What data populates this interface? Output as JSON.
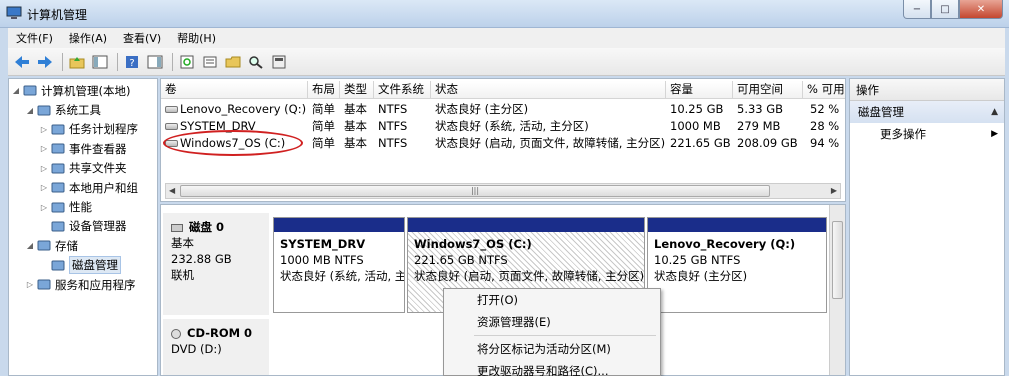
{
  "window": {
    "title": "计算机管理",
    "controls": [
      "−",
      "□",
      "✕"
    ]
  },
  "menu": [
    "文件(F)",
    "操作(A)",
    "查看(V)",
    "帮助(H)"
  ],
  "tree": [
    {
      "label": "计算机管理(本地)",
      "indent": 0,
      "twisty": "◢",
      "icon": "computer-icon"
    },
    {
      "label": "系统工具",
      "indent": 1,
      "twisty": "◢",
      "icon": "tools-icon"
    },
    {
      "label": "任务计划程序",
      "indent": 2,
      "twisty": "▷",
      "icon": "clock-icon"
    },
    {
      "label": "事件查看器",
      "indent": 2,
      "twisty": "▷",
      "icon": "event-viewer-icon"
    },
    {
      "label": "共享文件夹",
      "indent": 2,
      "twisty": "▷",
      "icon": "shared-folder-icon"
    },
    {
      "label": "本地用户和组",
      "indent": 2,
      "twisty": "▷",
      "icon": "users-icon"
    },
    {
      "label": "性能",
      "indent": 2,
      "twisty": "▷",
      "icon": "performance-icon"
    },
    {
      "label": "设备管理器",
      "indent": 2,
      "twisty": "",
      "icon": "device-manager-icon"
    },
    {
      "label": "存储",
      "indent": 1,
      "twisty": "◢",
      "icon": "storage-icon"
    },
    {
      "label": "磁盘管理",
      "indent": 2,
      "twisty": "",
      "icon": "disk-management-icon",
      "selected": true
    },
    {
      "label": "服务和应用程序",
      "indent": 1,
      "twisty": "▷",
      "icon": "services-icon"
    }
  ],
  "volume_table": {
    "columns": [
      "卷",
      "布局",
      "类型",
      "文件系统",
      "状态",
      "容量",
      "可用空间",
      "% 可用"
    ],
    "rows": [
      [
        "Lenovo_Recovery (Q:)",
        "简单",
        "基本",
        "NTFS",
        "状态良好 (主分区)",
        "10.25 GB",
        "5.33 GB",
        "52 %"
      ],
      [
        "SYSTEM_DRV",
        "简单",
        "基本",
        "NTFS",
        "状态良好 (系统, 活动, 主分区)",
        "1000 MB",
        "279 MB",
        "28 %"
      ],
      [
        "Windows7_OS (C:)",
        "简单",
        "基本",
        "NTFS",
        "状态良好 (启动, 页面文件, 故障转储, 主分区)",
        "221.65 GB",
        "208.09 GB",
        "94 %"
      ]
    ]
  },
  "disks": [
    {
      "name": "磁盘 0",
      "type": "基本",
      "size": "232.88 GB",
      "status": "联机",
      "partitions": [
        {
          "name": "SYSTEM_DRV",
          "size": "1000 MB NTFS",
          "status": "状态良好 (系统, 活动, 主"
        },
        {
          "name": "Windows7_OS  (C:)",
          "size": "221.65 GB NTFS",
          "status": "状态良好 (启动, 页面文件, 故障转储, 主分区)"
        },
        {
          "name": "Lenovo_Recovery  (Q:)",
          "size": "10.25 GB NTFS",
          "status": "状态良好 (主分区)"
        }
      ]
    },
    {
      "name": "CD-ROM 0",
      "type": "DVD (D:)"
    }
  ],
  "context_menu": [
    "打开(O)",
    "资源管理器(E)",
    "将分区标记为活动分区(M)",
    "更改驱动器号和路径(C)..."
  ],
  "actions": {
    "header": "操作",
    "section": "磁盘管理",
    "item": "更多操作"
  },
  "colors": {
    "partition_bar": "#1a2d8a",
    "highlight_ellipse": "#d02020"
  }
}
